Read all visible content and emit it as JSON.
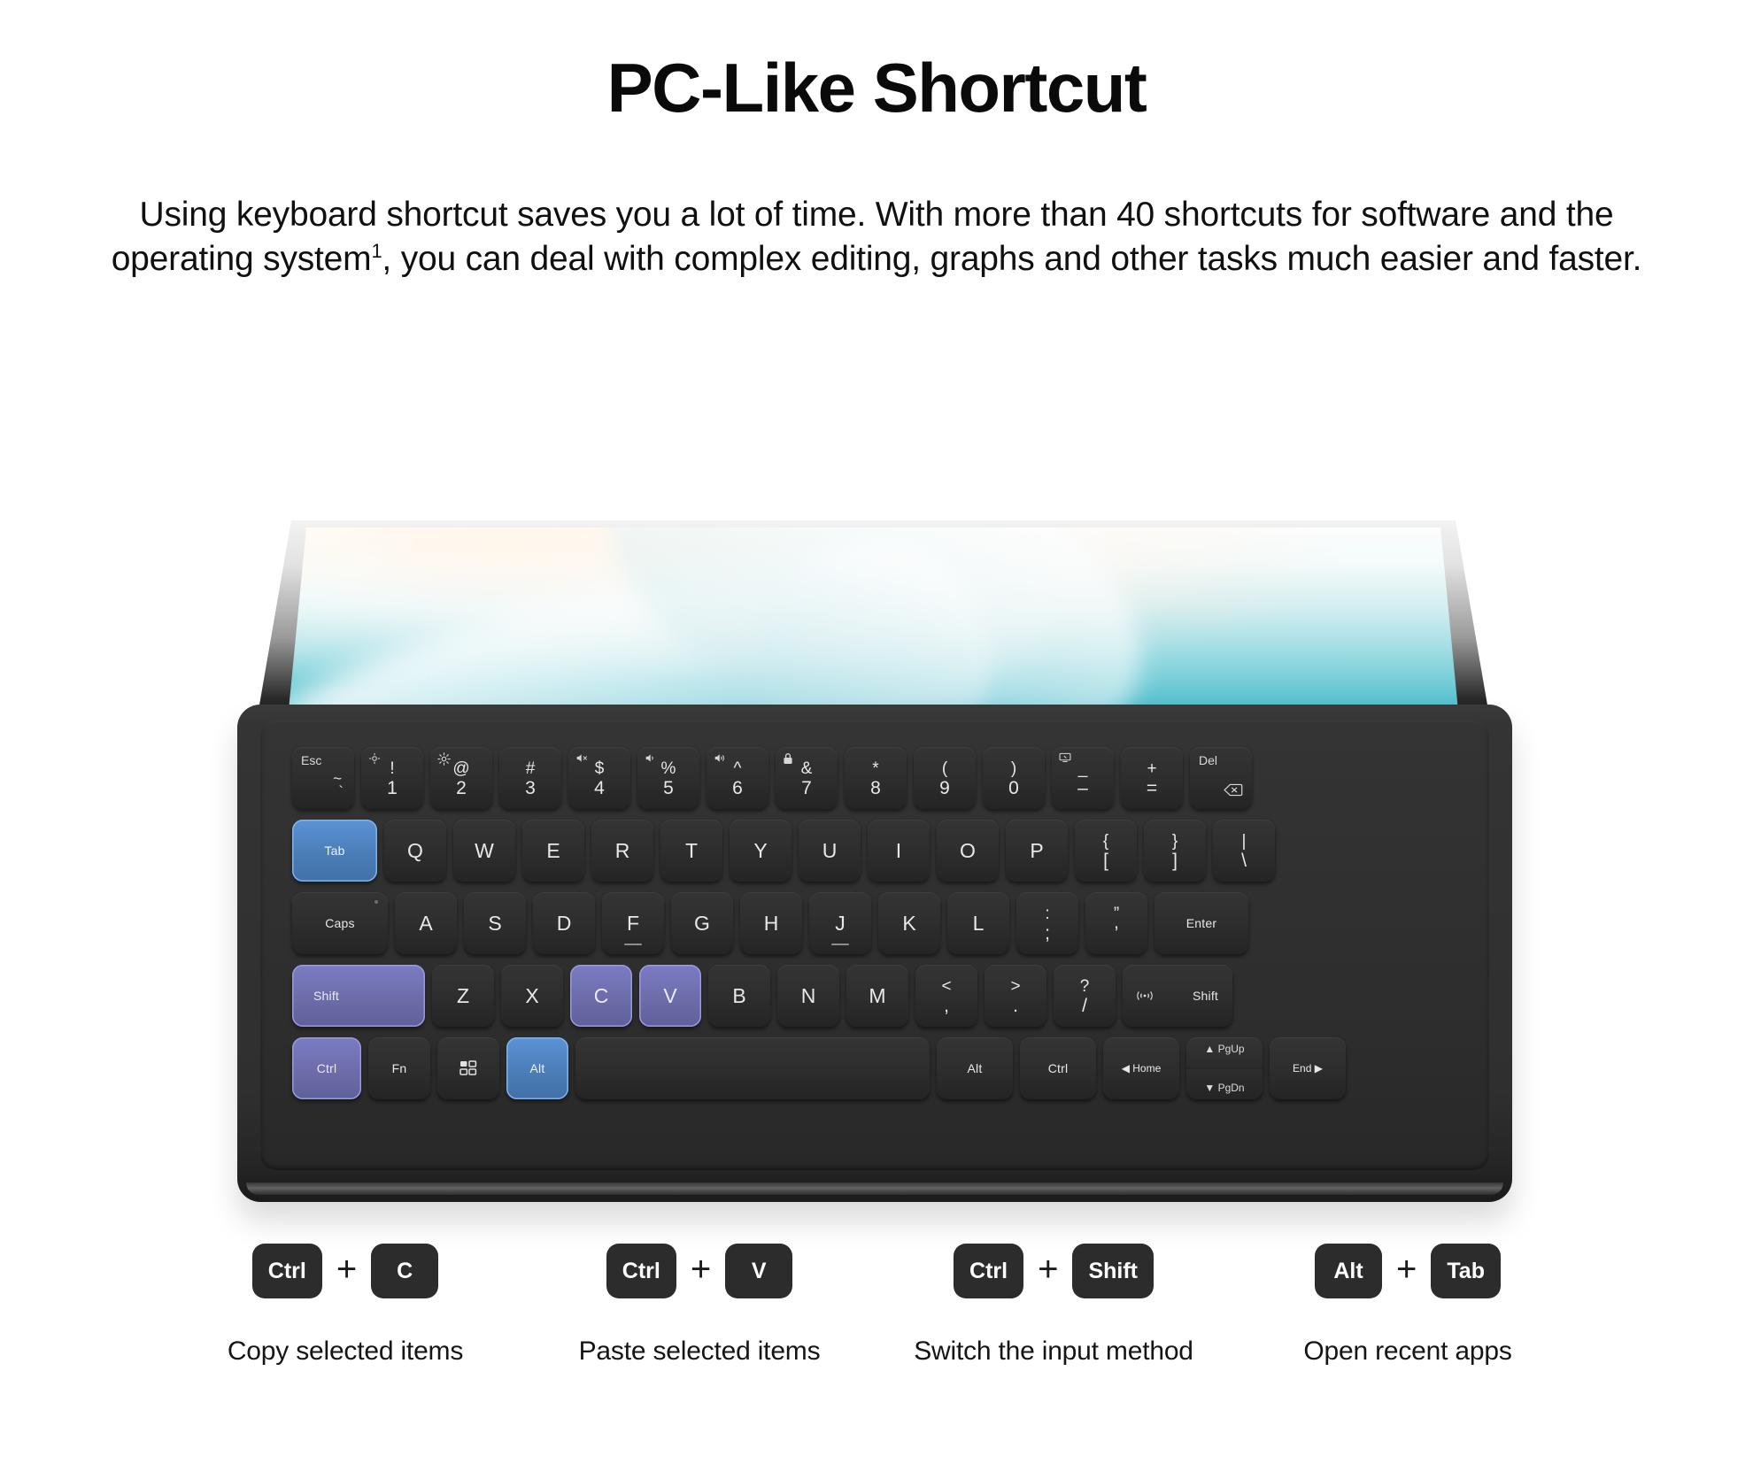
{
  "header": {
    "title": "PC-Like Shortcut",
    "description_part1": "Using keyboard shortcut saves you a lot of time. With more than 40 shortcuts for software and the operating system",
    "footnote_marker": "1",
    "description_part2": ", you can deal with complex editing, graphs and other tasks much easier and faster."
  },
  "colors": {
    "highlight_blue": "#5b93d6",
    "highlight_purple": "#7b7bc4",
    "key_dark": "#2e2e2e",
    "keyboard_body": "#303030",
    "screen_teal": "#63c6d2",
    "text_dark": "#0a0a0a"
  },
  "keyboard": {
    "rows": [
      {
        "name": "function-number-row",
        "keys": [
          {
            "id": "esc",
            "type": "corner",
            "top": "Esc",
            "mid": "~",
            "bottom": "`",
            "width": "w-esc"
          },
          {
            "id": "1",
            "type": "fn-dual",
            "icon": "brightness-down-icon",
            "top": "!",
            "bottom": "1"
          },
          {
            "id": "2",
            "type": "fn-dual",
            "icon": "brightness-up-icon",
            "top": "@",
            "bottom": "2"
          },
          {
            "id": "3",
            "type": "dual",
            "top": "#",
            "bottom": "3"
          },
          {
            "id": "4",
            "type": "fn-dual",
            "icon": "volume-mute-icon",
            "top": "$",
            "bottom": "4"
          },
          {
            "id": "5",
            "type": "fn-dual",
            "icon": "volume-down-icon",
            "top": "%",
            "bottom": "5"
          },
          {
            "id": "6",
            "type": "fn-dual",
            "icon": "volume-up-icon",
            "top": "^",
            "bottom": "6"
          },
          {
            "id": "7",
            "type": "fn-dual",
            "icon": "lock-icon",
            "top": "&",
            "bottom": "7"
          },
          {
            "id": "8",
            "type": "dual",
            "top": "*",
            "bottom": "8"
          },
          {
            "id": "9",
            "type": "dual",
            "top": "(",
            "bottom": "9"
          },
          {
            "id": "0",
            "type": "dual",
            "top": ")",
            "bottom": "0"
          },
          {
            "id": "minus",
            "type": "fn-dual",
            "icon": "screenshot-icon",
            "top": "_",
            "bottom": "–"
          },
          {
            "id": "equal",
            "type": "dual",
            "top": "+",
            "bottom": "="
          },
          {
            "id": "backspace",
            "type": "del",
            "top": "Del",
            "icon": "backspace-icon"
          }
        ]
      },
      {
        "name": "qwerty-row",
        "keys": [
          {
            "id": "tab",
            "label": "Tab",
            "width": "w-tab",
            "highlight": "blue",
            "size": "sm"
          },
          {
            "id": "q",
            "label": "Q"
          },
          {
            "id": "w",
            "label": "W"
          },
          {
            "id": "e",
            "label": "E"
          },
          {
            "id": "r",
            "label": "R"
          },
          {
            "id": "t",
            "label": "T"
          },
          {
            "id": "y",
            "label": "Y"
          },
          {
            "id": "u",
            "label": "U"
          },
          {
            "id": "i",
            "label": "I"
          },
          {
            "id": "o",
            "label": "O"
          },
          {
            "id": "p",
            "label": "P"
          },
          {
            "id": "bracket-left",
            "type": "dual",
            "top": "{",
            "bottom": "["
          },
          {
            "id": "bracket-right",
            "type": "dual",
            "top": "}",
            "bottom": "]"
          },
          {
            "id": "backslash",
            "type": "dual",
            "top": "|",
            "bottom": "\\"
          }
        ]
      },
      {
        "name": "home-row",
        "keys": [
          {
            "id": "caps",
            "label": "Caps",
            "width": "w-caps",
            "size": "sm",
            "led": true
          },
          {
            "id": "a",
            "label": "A"
          },
          {
            "id": "s",
            "label": "S"
          },
          {
            "id": "d",
            "label": "D"
          },
          {
            "id": "f",
            "label": "F",
            "homing": true
          },
          {
            "id": "g",
            "label": "G"
          },
          {
            "id": "h",
            "label": "H"
          },
          {
            "id": "j",
            "label": "J",
            "homing": true
          },
          {
            "id": "k",
            "label": "K"
          },
          {
            "id": "l",
            "label": "L"
          },
          {
            "id": "semicolon",
            "type": "dual",
            "top": ":",
            "bottom": ";"
          },
          {
            "id": "quote",
            "type": "dual",
            "top": "”",
            "bottom": "’"
          },
          {
            "id": "enter",
            "label": "Enter",
            "width": "w-enter",
            "size": "sm"
          }
        ]
      },
      {
        "name": "shift-row",
        "keys": [
          {
            "id": "shift-left",
            "label": "Shift",
            "width": "w-shift",
            "highlight": "purple",
            "size": "sm"
          },
          {
            "id": "z",
            "label": "Z"
          },
          {
            "id": "x",
            "label": "X"
          },
          {
            "id": "c",
            "label": "C",
            "highlight": "purple"
          },
          {
            "id": "v",
            "label": "V",
            "highlight": "purple"
          },
          {
            "id": "b",
            "label": "B"
          },
          {
            "id": "n",
            "label": "N"
          },
          {
            "id": "m",
            "label": "M"
          },
          {
            "id": "comma",
            "type": "dual",
            "top": "<",
            "bottom": ","
          },
          {
            "id": "period",
            "type": "dual",
            "top": ">",
            "bottom": "."
          },
          {
            "id": "slash",
            "type": "dual",
            "top": "?",
            "bottom": "/"
          },
          {
            "id": "shift-right",
            "label": "Shift",
            "width": "w-rshift",
            "size": "sm",
            "icon": "wireless-icon"
          }
        ]
      },
      {
        "name": "modifier-row",
        "keys": [
          {
            "id": "ctrl-left",
            "label": "Ctrl",
            "width": "w-ctrl",
            "highlight": "purple",
            "size": "sm"
          },
          {
            "id": "fn",
            "label": "Fn",
            "width": "w-fn",
            "size": "sm"
          },
          {
            "id": "apps",
            "icon": "app-grid-icon",
            "width": "w-fn"
          },
          {
            "id": "alt-left",
            "label": "Alt",
            "width": "w-fn",
            "highlight": "blue",
            "size": "sm"
          },
          {
            "id": "space",
            "label": "",
            "width": "w-space"
          },
          {
            "id": "alt-right",
            "label": "Alt",
            "width": "w-nav",
            "size": "sm"
          },
          {
            "id": "ctrl-right",
            "label": "Ctrl",
            "width": "w-nav",
            "size": "sm"
          },
          {
            "id": "home",
            "label": "◀ Home",
            "width": "w-nav",
            "size": "xs"
          },
          {
            "id": "pageupdown",
            "type": "split",
            "top": "▲ PgUp",
            "bottom": "▼ PgDn",
            "width": "w-pg"
          },
          {
            "id": "end",
            "label": "End ▶",
            "width": "w-nav",
            "size": "xs"
          }
        ]
      }
    ]
  },
  "legend": {
    "plus_symbol": "+",
    "items": [
      {
        "key1": "Ctrl",
        "key2": "C",
        "description": "Copy selected items"
      },
      {
        "key1": "Ctrl",
        "key2": "V",
        "description": "Paste selected items"
      },
      {
        "key1": "Ctrl",
        "key2": "Shift",
        "description": "Switch the input method"
      },
      {
        "key1": "Alt",
        "key2": "Tab",
        "description": "Open recent apps"
      }
    ]
  }
}
